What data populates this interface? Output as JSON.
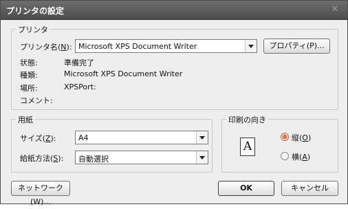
{
  "window": {
    "title": "プリンタの設定",
    "close_glyph": "✕"
  },
  "printer": {
    "group_label": "プリンタ",
    "name_label": "プリンタ名(",
    "name_key": "N",
    "name_label_end": "):",
    "name_value": "Microsoft XPS Document Writer",
    "properties_button": "プロパティ(P)...",
    "status_label": "状態:",
    "status_value": "準備完了",
    "type_label": "種類:",
    "type_value": "Microsoft XPS Document Writer",
    "location_label": "場所:",
    "location_value": "XPSPort:",
    "comment_label": "コメント:"
  },
  "paper": {
    "group_label": "用紙",
    "size_label": "サイズ(",
    "size_key": "Z",
    "size_label_end": "):",
    "size_value": "A4",
    "source_label": "給紙方法(",
    "source_key": "S",
    "source_label_end": "):",
    "source_value": "自動選択"
  },
  "orientation": {
    "group_label": "印刷の向き",
    "icon_letter": "A",
    "portrait_label": "縦(",
    "portrait_key": "O",
    "portrait_end": ")",
    "landscape_label": "横(",
    "landscape_key": "A",
    "landscape_end": ")",
    "selected": "portrait"
  },
  "footer": {
    "network_button": "ネットワーク(W)...",
    "ok_button": "OK",
    "cancel_button": "キャンセル"
  }
}
